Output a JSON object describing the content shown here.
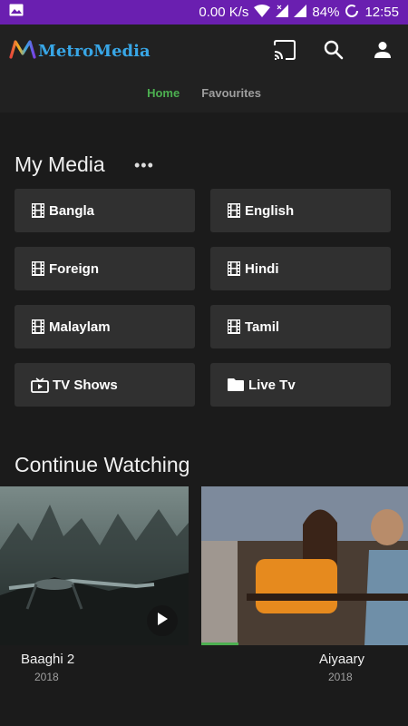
{
  "status_bar": {
    "speed": "0.00 K/s",
    "battery": "84%",
    "time": "12:55",
    "colors": {
      "background": "#6a1fb0"
    }
  },
  "app_bar": {
    "logo_text": "MetroMedia",
    "tabs": [
      {
        "label": "Home",
        "active": true
      },
      {
        "label": "Favourites",
        "active": false
      }
    ],
    "actions": [
      "cast-icon",
      "search-icon",
      "account-icon"
    ]
  },
  "my_media": {
    "title": "My Media",
    "more_label": "•••",
    "tiles": [
      {
        "label": "Bangla",
        "icon": "film-icon"
      },
      {
        "label": "English",
        "icon": "film-icon"
      },
      {
        "label": "Foreign",
        "icon": "film-icon"
      },
      {
        "label": "Hindi",
        "icon": "film-icon"
      },
      {
        "label": "Malaylam",
        "icon": "film-icon"
      },
      {
        "label": "Tamil",
        "icon": "film-icon"
      },
      {
        "label": "TV Shows",
        "icon": "tv-icon"
      },
      {
        "label": "Live Tv",
        "icon": "folder-icon"
      }
    ]
  },
  "continue_watching": {
    "title": "Continue Watching",
    "items": [
      {
        "name": "Baaghi 2",
        "year": "2018",
        "progress": 0
      },
      {
        "name": "Aiyaary",
        "year": "2018",
        "progress": 0.18
      }
    ]
  },
  "colors": {
    "accent": "#4caf50",
    "logo": "#38a6e6",
    "tile": "#303030",
    "background": "#1b1b1b"
  }
}
